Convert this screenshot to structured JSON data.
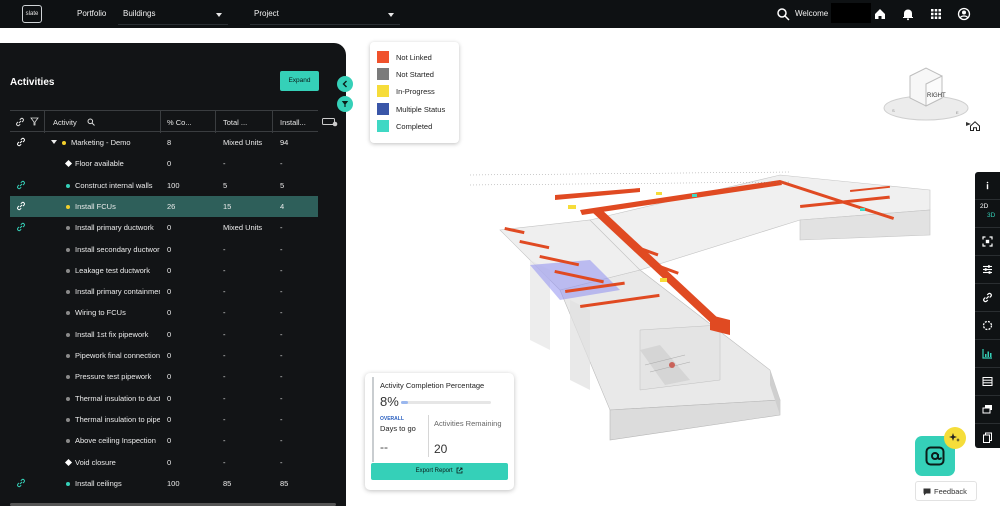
{
  "topbar": {
    "logo_text": "slate",
    "portfolio_label": "Portfolio",
    "buildings_select": "Buildings",
    "project_select": "Project",
    "welcome_text": "Welcome"
  },
  "panel": {
    "title": "Activities",
    "expand_label": "Expand",
    "columns": [
      "Activity",
      "% Co...",
      "Total ...",
      "Install..."
    ],
    "rows": [
      {
        "name": "Marketing - Demo",
        "pct": "8",
        "total": "Mixed Units",
        "installed": "94",
        "marker": "dot",
        "marker_color": "#f2cf2c",
        "linked": true,
        "group": true
      },
      {
        "name": "Floor available",
        "pct": "0",
        "total": "-",
        "installed": "-",
        "marker": "diamond",
        "marker_color": "#ffffff",
        "linked": false
      },
      {
        "name": "Construct internal walls",
        "pct": "100",
        "total": "5",
        "installed": "5",
        "marker": "dot",
        "marker_color": "#35d0b8",
        "linked": true
      },
      {
        "name": "Install FCUs",
        "pct": "26",
        "total": "15",
        "installed": "4",
        "marker": "dot",
        "marker_color": "#f2cf2c",
        "linked": true,
        "selected": true
      },
      {
        "name": "Install primary ductwork",
        "pct": "0",
        "total": "Mixed Units",
        "installed": "-",
        "marker": "dot",
        "marker_color": "#8a8a8a",
        "linked": true
      },
      {
        "name": "Install secondary ductwork",
        "pct": "0",
        "total": "-",
        "installed": "-",
        "marker": "dot",
        "marker_color": "#8a8a8a",
        "linked": false
      },
      {
        "name": "Leakage test ductwork",
        "pct": "0",
        "total": "-",
        "installed": "-",
        "marker": "dot",
        "marker_color": "#8a8a8a",
        "linked": false
      },
      {
        "name": "Install primary containment",
        "pct": "0",
        "total": "-",
        "installed": "-",
        "marker": "dot",
        "marker_color": "#8a8a8a",
        "linked": false
      },
      {
        "name": "Wiring to FCUs",
        "pct": "0",
        "total": "-",
        "installed": "-",
        "marker": "dot",
        "marker_color": "#8a8a8a",
        "linked": false
      },
      {
        "name": "Install 1st fix pipework",
        "pct": "0",
        "total": "-",
        "installed": "-",
        "marker": "dot",
        "marker_color": "#8a8a8a",
        "linked": false
      },
      {
        "name": "Pipework final connections",
        "pct": "0",
        "total": "-",
        "installed": "-",
        "marker": "dot",
        "marker_color": "#8a8a8a",
        "linked": false
      },
      {
        "name": "Pressure test pipework",
        "pct": "0",
        "total": "-",
        "installed": "-",
        "marker": "dot",
        "marker_color": "#8a8a8a",
        "linked": false
      },
      {
        "name": "Thermal insulation to ductwork",
        "pct": "0",
        "total": "-",
        "installed": "-",
        "marker": "dot",
        "marker_color": "#8a8a8a",
        "linked": false
      },
      {
        "name": "Thermal insulation to pipework",
        "pct": "0",
        "total": "-",
        "installed": "-",
        "marker": "dot",
        "marker_color": "#8a8a8a",
        "linked": false
      },
      {
        "name": "Above ceiling Inspection",
        "pct": "0",
        "total": "-",
        "installed": "-",
        "marker": "dot",
        "marker_color": "#8a8a8a",
        "linked": false
      },
      {
        "name": "Void closure",
        "pct": "0",
        "total": "-",
        "installed": "-",
        "marker": "diamond",
        "marker_color": "#ffffff",
        "linked": false
      },
      {
        "name": "Install ceilings",
        "pct": "100",
        "total": "85",
        "installed": "85",
        "marker": "dot",
        "marker_color": "#35d0b8",
        "linked": true
      }
    ]
  },
  "legend": {
    "items": [
      {
        "label": "Not Linked",
        "color": "#f0522c"
      },
      {
        "label": "Not Started",
        "color": "#7b7b7b"
      },
      {
        "label": "In-Progress",
        "color": "#f6dc3a"
      },
      {
        "label": "Multiple Status",
        "color": "#3a56a8"
      },
      {
        "label": "Completed",
        "color": "#3fd8c4"
      }
    ]
  },
  "viewcube": {
    "face_label": "RIGHT"
  },
  "toolbar": {
    "dim_2d": "2D",
    "dim_3d": "3D"
  },
  "completion": {
    "title": "Activity Completion Percentage",
    "percent_text": "8%",
    "percent_value": 8,
    "overall_label": "OVERALL",
    "days_label": "Days to go",
    "days_value": "--",
    "activities_label": "Activities Remaining",
    "activities_value": "20",
    "export_label": "Export Report"
  },
  "feedback_label": "Feedback",
  "colors": {
    "accent": "#35d0b8",
    "panel_bg": "#121416",
    "topbar_bg": "#0e1113",
    "selected_row": "#2e5f5a"
  }
}
